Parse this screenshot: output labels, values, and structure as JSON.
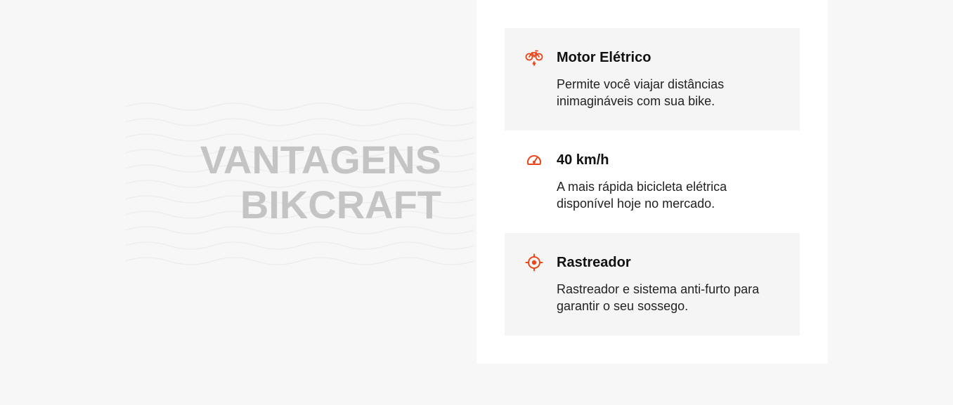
{
  "section": {
    "title_line1": "VANTAGENS",
    "title_line2": "BIKCRAFT"
  },
  "advantages": [
    {
      "icon": "electric-bike-icon",
      "title": "Motor Elétrico",
      "text": "Permite você viajar distâncias inimagináveis com sua bike."
    },
    {
      "icon": "speedometer-icon",
      "title": "40 km/h",
      "text": "A mais rápida bicicleta elétrica disponível hoje no mercado."
    },
    {
      "icon": "target-tracker-icon",
      "title": "Rastreador",
      "text": "Rastreador e sistema anti-furto para garantir o seu sossego."
    }
  ],
  "colors": {
    "background": "#f7f7f7",
    "panel": "#ffffff",
    "item_shaded": "#f5f5f5",
    "accent": "#e8471c",
    "heading_gray": "#c4c4c4",
    "text": "#222222"
  }
}
